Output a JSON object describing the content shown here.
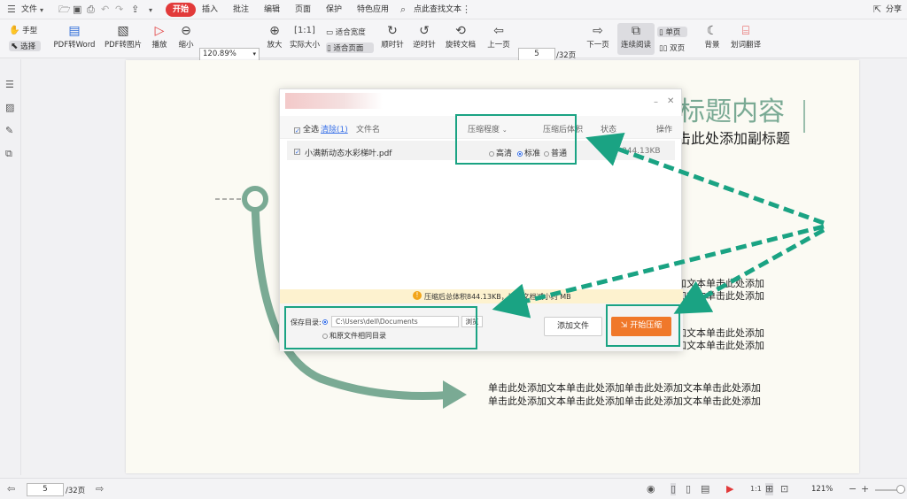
{
  "menubar": {
    "file": "文件",
    "tabs": [
      "开始",
      "插入",
      "批注",
      "编辑",
      "页面",
      "保护",
      "特色应用"
    ],
    "search": "点此查找文本",
    "share": "分享"
  },
  "toolbar": {
    "hand": "手型",
    "select": "选择",
    "pdf_word": "PDF转Word",
    "pdf_img": "PDF转图片",
    "play": "播放",
    "zoom_out": "缩小",
    "zoom_value": "120.89%",
    "zoom_in": "放大",
    "actual": "实际大小",
    "fit_width": "适合宽度",
    "fit_page": "适合页面",
    "rotate_cw": "顺时针",
    "rotate_ccw": "逆时针",
    "rotate_doc": "旋转文档",
    "prev": "上一页",
    "page": "5",
    "total": "/32页",
    "next": "下一页",
    "continuous": "连续阅读",
    "single": "单页",
    "double": "双页",
    "bg": "背景",
    "translate": "划词翻译"
  },
  "slide": {
    "title": "标题内容",
    "subtitle": "击此处添加副标题",
    "text1a": "加文本单击此处添加",
    "text1b": "加文本单击此处添加",
    "text2a": "加文本单击此处添加",
    "text2b": "加文本单击此处添加",
    "text3a": "单击此处添加文本单击此处添加单击此处添加文本单击此处添加",
    "text3b": "单击此处添加文本单击此处添加单击此处添加文本单击此处添加"
  },
  "dialog": {
    "select_all": "全选",
    "clear": "清除(1)",
    "col_name": "文件名",
    "col_level": "压缩程度",
    "col_size": "压缩后体积",
    "col_status": "状态",
    "col_action": "操作",
    "file_name": "小满新动态水彩梯叶.pdf",
    "opt_high": "高清",
    "opt_std": "标准",
    "opt_normal": "普通",
    "size": "844.13KB",
    "info": "压缩后总体积844.13KB，比原文档减小约 MB",
    "save_dir_label": "保存目录:",
    "save_dir": "C:\\Users\\dell\\Documents",
    "browse": "浏览",
    "same_dir": "和原文件相同目录",
    "add_file": "添加文件",
    "start": "开始压缩"
  },
  "status": {
    "page": "5",
    "total": "/32页",
    "zoom": "121%"
  },
  "colors": {
    "accent": "#e23a3a",
    "teal": "#1aa383",
    "orange": "#f0782a",
    "arrow": "#7aaa94"
  }
}
